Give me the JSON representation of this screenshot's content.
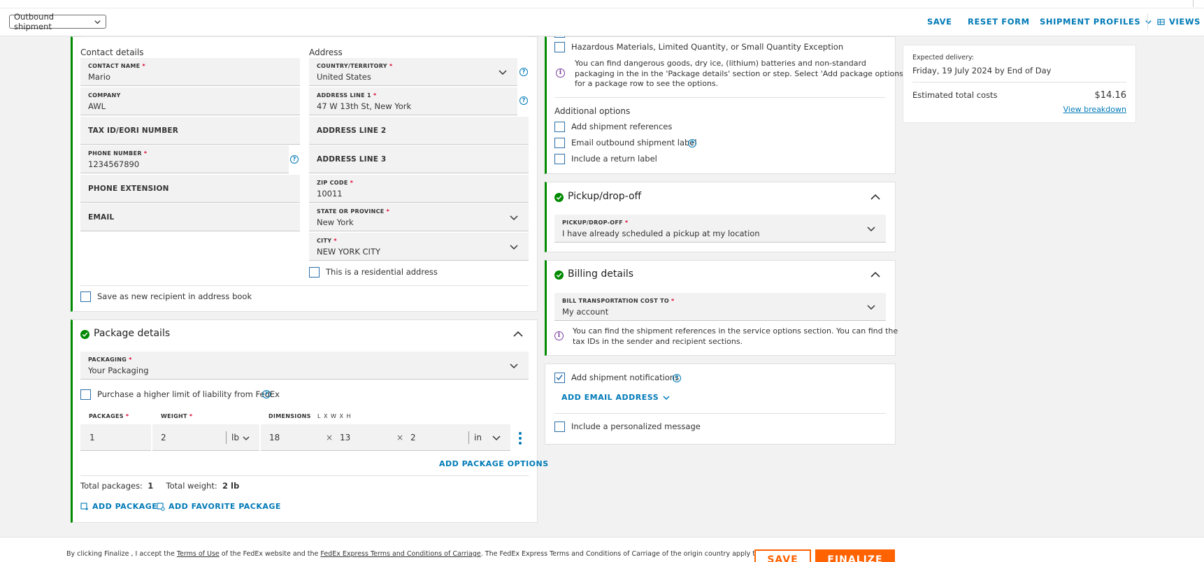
{
  "topbar": {
    "shipment_type": "Outbound shipment",
    "save": "SAVE",
    "reset": "RESET FORM",
    "profiles": "SHIPMENT PROFILES",
    "views": "VIEWS"
  },
  "recipient": {
    "contact_heading": "Contact details",
    "address_heading": "Address",
    "contact_name_label": "CONTACT NAME",
    "contact_name": "Mario",
    "company_label": "COMPANY",
    "company": "AWL",
    "tax_id_placeholder": "TAX ID/EORI NUMBER",
    "phone_label": "PHONE NUMBER",
    "phone": "1234567890",
    "phone_ext_placeholder": "PHONE EXTENSION",
    "email_placeholder": "EMAIL",
    "country_label": "COUNTRY/TERRITORY",
    "country": "United States",
    "address1_label": "ADDRESS LINE 1",
    "address1": "47 W 13th St, New York",
    "address2_placeholder": "ADDRESS LINE 2",
    "address3_placeholder": "ADDRESS LINE 3",
    "zip_label": "ZIP CODE",
    "zip": "10011",
    "state_label": "STATE OR PROVINCE",
    "state": "New York",
    "city_label": "CITY",
    "city": "NEW YORK CITY",
    "residential": "This is a residential address",
    "save_recipient": "Save as new recipient in address book",
    "req": "*",
    "help": "?"
  },
  "package": {
    "title": "Package details",
    "packaging_label": "PACKAGING",
    "packaging": "Your Packaging",
    "liability": "Purchase a higher limit of liability from FedEx",
    "packages_label": "PACKAGES",
    "weight_label": "WEIGHT",
    "dimensions_label": "DIMENSIONS",
    "dimensions_hint": "L X W X H",
    "packages": "1",
    "weight": "2",
    "weight_unit": "lb",
    "length": "18",
    "width": "13",
    "height": "2",
    "dim_unit": "in",
    "times": "×",
    "add_options": "ADD PACKAGE OPTIONS",
    "total_packages_label": "Total packages:",
    "total_packages": "1",
    "total_weight_label": "Total weight:",
    "total_weight": "2 lb",
    "add_package": "ADD PACKAGE",
    "add_favorite": "ADD FAVORITE PACKAGE"
  },
  "service": {
    "hazmat": "Hazardous Materials, Limited Quantity, or Small Quantity Exception",
    "dangerous_info_1": "You can find dangerous goods, dry ice, (lithium) batteries and non-standard",
    "dangerous_info_2": "packaging in the in the 'Package details' section or step. Select 'Add package options'",
    "dangerous_info_3": "for a package row to see the options.",
    "additional_heading": "Additional options",
    "add_references": "Add shipment references",
    "email_label": "Email outbound shipment label",
    "return_label": "Include a return label",
    "info_i": "i"
  },
  "pickup": {
    "title": "Pickup/drop-off",
    "field_label": "PICKUP/DROP-OFF",
    "value": "I have already scheduled a pickup at my location"
  },
  "billing": {
    "title": "Billing details",
    "field_label": "BILL TRANSPORTATION COST TO",
    "value": "My account",
    "info_1": "You can find the shipment references in the service options section. You can find the",
    "info_2": "tax IDs in the sender and recipient sections."
  },
  "notifications": {
    "add": "Add shipment notifications",
    "add_email": "ADD EMAIL ADDRESS",
    "personal_message": "Include a personalized message"
  },
  "summary": {
    "delivery_label": "Expected delivery:",
    "delivery": "Friday, 19 July 2024 by End of Day",
    "cost_label": "Estimated total costs",
    "cost": "$14.16",
    "breakdown": "View breakdown"
  },
  "footer": {
    "t1": "By clicking  Finalize , I accept the ",
    "terms_of_use": "Terms of Use",
    "t2": " of the FedEx website and the ",
    "terms_carriage": "FedEx Express Terms and Conditions of Carriage",
    "t3": ".  The FedEx Express Terms and Conditions of Carriage of the origin country apply to all",
    "save": "SAVE",
    "finalize": "FINALIZE"
  }
}
